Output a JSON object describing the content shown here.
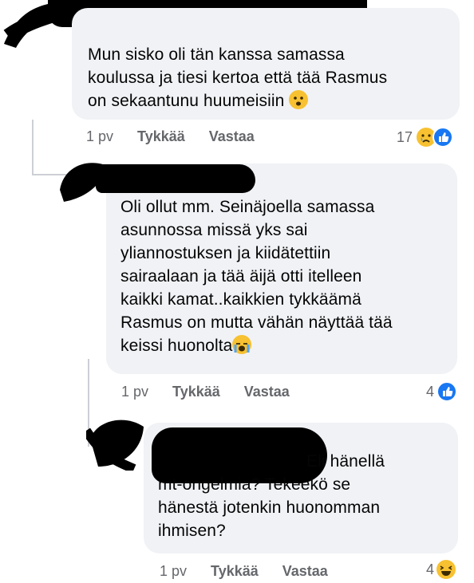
{
  "comments": [
    {
      "text_lines": [
        "Mun sisko oli tän kanssa samassa",
        "koulussa ja tiesi kertoa että tää Rasmus",
        "on sekaantunu huumeisiin"
      ],
      "time": "1 pv",
      "like_label": "Tykkää",
      "reply_label": "Vastaa",
      "reaction_count": "17",
      "reaction_icons": [
        "sad-emoji-icon",
        "like-thumb-icon"
      ]
    },
    {
      "text_lines": [
        "Oli ollut mm. Seinäjoella samassa",
        "asunnossa missä yks sai",
        "yliannostuksen ja kiidätettiin",
        "sairaalaan ja tää äijä otti itelleen",
        "kaikki kamat..kaikkien tykkäämä",
        "Rasmus on mutta vähän näyttää tää",
        "keissi huonolta"
      ],
      "time": "1 pv",
      "like_label": "Tykkää",
      "reply_label": "Vastaa",
      "reaction_count": "4",
      "reaction_icons": [
        "like-thumb-icon"
      ]
    },
    {
      "text_lines": [
        "Eli hänellä",
        "mt-ongelmia? Tekeekö se",
        "hänestä jotenkin huonomman",
        "ihmisen?"
      ],
      "time": "1 pv",
      "like_label": "Tykkää",
      "reply_label": "Vastaa",
      "reaction_count": "4",
      "reaction_icons": [
        "laughing-emoji-icon"
      ]
    }
  ],
  "colors": {
    "bubble": "#f0f2f5",
    "meta": "#65676b",
    "like_blue": "#1877f2",
    "emoji_yellow": "#f7c131"
  }
}
